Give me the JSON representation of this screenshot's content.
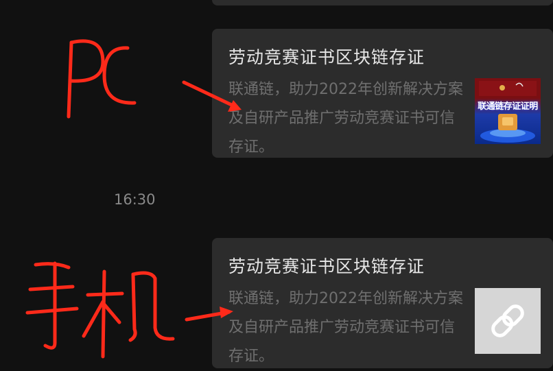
{
  "messages": [
    {
      "title": "劳动竞赛证书区块链存证",
      "description": "联通链，助力2022年创新解决方案及自研产品推广劳动竞赛证书可信存证。",
      "thumbnail": {
        "caption": "联通链存证证明"
      }
    },
    {
      "title": "劳动竞赛证书区块链存证",
      "description": "联通链，助力2022年创新解决方案及自研产品推广劳动竞赛证书可信存证。",
      "thumbnail": {
        "icon": "link-icon"
      }
    }
  ],
  "timestamp": "16:30",
  "annotations": {
    "pc_label": "PC",
    "mobile_label": "手机",
    "color": "#ff2a1a"
  }
}
